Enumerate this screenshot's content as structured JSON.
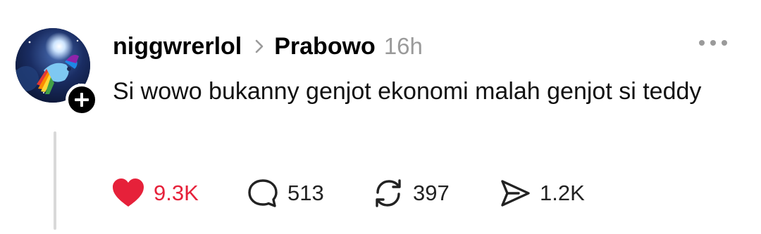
{
  "post": {
    "username": "niggwrerlol",
    "community": "Prabowo",
    "time": "16h",
    "text": "Si wowo bukanny genjot ekonomi malah genjot si teddy",
    "likes": "9.3K",
    "replies": "513",
    "reposts": "397",
    "shares": "1.2K"
  },
  "colors": {
    "like_red": "#e6213a",
    "muted_gray": "#9a9a9a",
    "thread_line": "#d9d9d9"
  },
  "icons": [
    "avatar",
    "plus-icon",
    "chevron-right-icon",
    "more-icon",
    "heart-icon",
    "comment-icon",
    "repost-icon",
    "share-icon"
  ]
}
